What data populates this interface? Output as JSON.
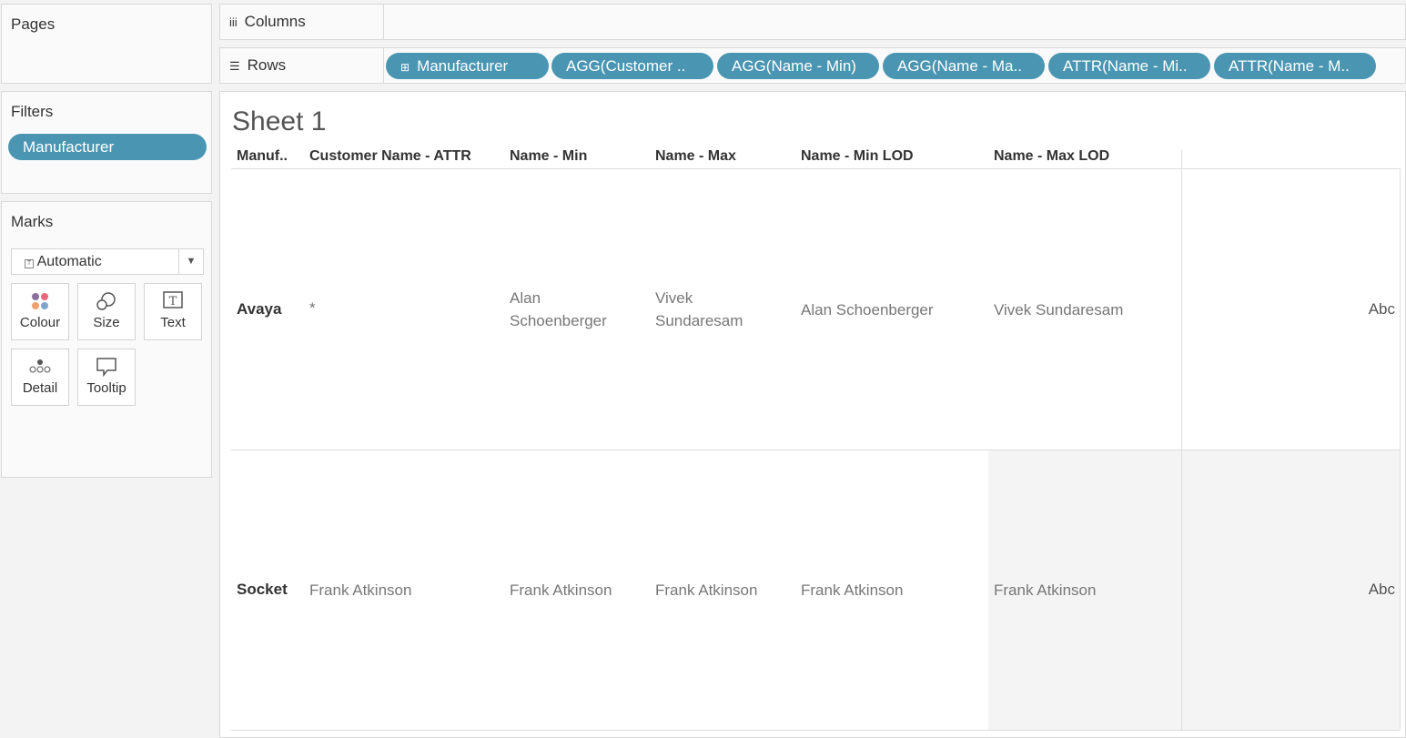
{
  "pages": {
    "title": "Pages"
  },
  "filters": {
    "title": "Filters",
    "pills": [
      "Manufacturer"
    ]
  },
  "marks": {
    "title": "Marks",
    "type": "Automatic",
    "cards": [
      "Colour",
      "Size",
      "Text",
      "Detail",
      "Tooltip"
    ]
  },
  "columns": {
    "label": "Columns"
  },
  "rows": {
    "label": "Rows",
    "pills": [
      "Manufacturer",
      "AGG(Customer ..",
      "AGG(Name - Min)",
      "AGG(Name - Ma..",
      "ATTR(Name - Mi..",
      "ATTR(Name - M.."
    ]
  },
  "sheet": {
    "title": "Sheet 1",
    "headers": [
      "Manuf..",
      "Customer Name - ATTR",
      "Name - Min",
      "Name - Max",
      "Name - Min LOD",
      "Name - Max LOD"
    ],
    "rows": [
      {
        "manufacturer": "Avaya",
        "customer": "*",
        "min": "Alan Schoenberger",
        "max": "Vivek Sundaresam",
        "min_lod": "Alan Schoenberger",
        "max_lod": "Vivek Sundaresam",
        "abc": "Abc"
      },
      {
        "manufacturer": "Socket",
        "customer": "Frank Atkinson",
        "min": "Frank Atkinson",
        "max": "Frank Atkinson",
        "min_lod": "Frank Atkinson",
        "max_lod": "Frank Atkinson",
        "abc": "Abc"
      }
    ]
  },
  "colors": {
    "pill": "#4a96b2"
  }
}
